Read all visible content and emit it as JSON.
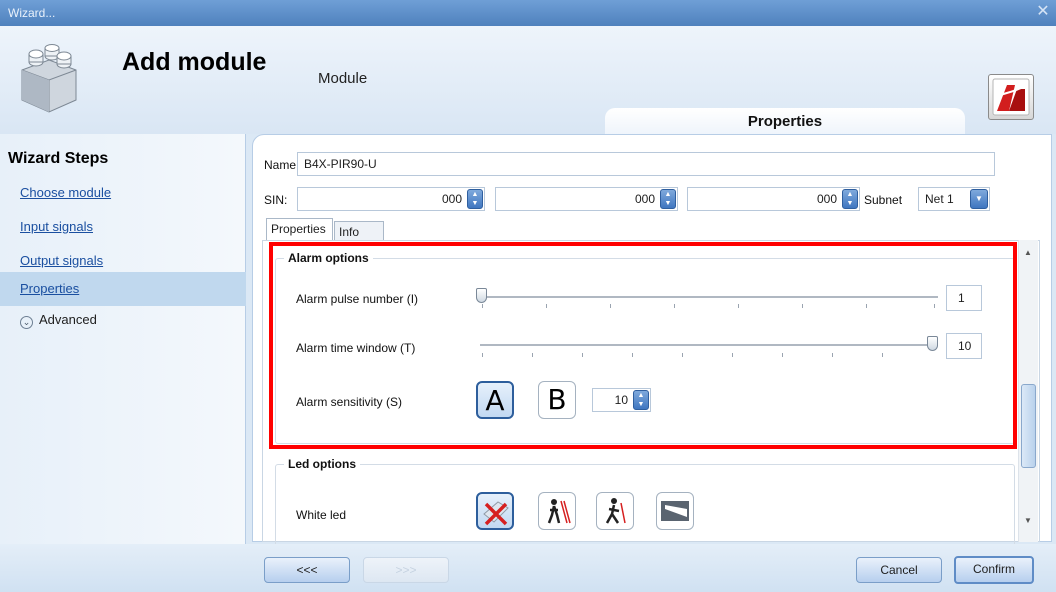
{
  "window": {
    "title": "Wizard...",
    "close_glyph": "✕"
  },
  "header": {
    "title": "Add module",
    "subtitle": "Module",
    "module_icon": "module-blocks-icon",
    "help_icon": "help-manual-icon"
  },
  "properties_header": "Properties",
  "sidebar": {
    "title": "Wizard Steps",
    "items": [
      {
        "label": "Choose module"
      },
      {
        "label": "Input signals"
      },
      {
        "label": "Output signals"
      },
      {
        "label": "Properties",
        "active": true
      }
    ],
    "advanced": {
      "label": "Advanced",
      "icon": "chevron-down-icon"
    }
  },
  "form": {
    "name_label": "Name",
    "name_value": "B4X-PIR90-U",
    "sin_label": "SIN:",
    "sin_values": [
      "000",
      "000",
      "000"
    ],
    "subnet_label": "Subnet",
    "subnet_value": "Net 1"
  },
  "tabs": [
    {
      "label": "Properties",
      "active": true
    },
    {
      "label": "Info",
      "active": false
    }
  ],
  "alarm_options": {
    "title": "Alarm options",
    "pulse": {
      "label": "Alarm pulse number (I)",
      "value": "1",
      "level": 0.0
    },
    "time_window": {
      "label": "Alarm time window (T)",
      "value": "10",
      "level": 1.0
    },
    "sensitivity": {
      "label": "Alarm sensitivity (S)",
      "btn_a": "A",
      "btn_b": "B",
      "selected": "A",
      "value": "10"
    }
  },
  "led_options": {
    "title": "Led options",
    "white_led_label": "White led",
    "buttons": [
      "led-off-icon",
      "person-detect-icon",
      "walking-person-icon",
      "light-beam-icon"
    ]
  },
  "footer": {
    "prev_label": "<<<",
    "next_label": ">>>",
    "cancel_label": "Cancel",
    "confirm_label": "Confirm"
  },
  "colors": {
    "chrome": "#4f81bd",
    "panel": "#dbe8f5",
    "highlight": "#ff0000",
    "link": "#1a4fa0"
  }
}
